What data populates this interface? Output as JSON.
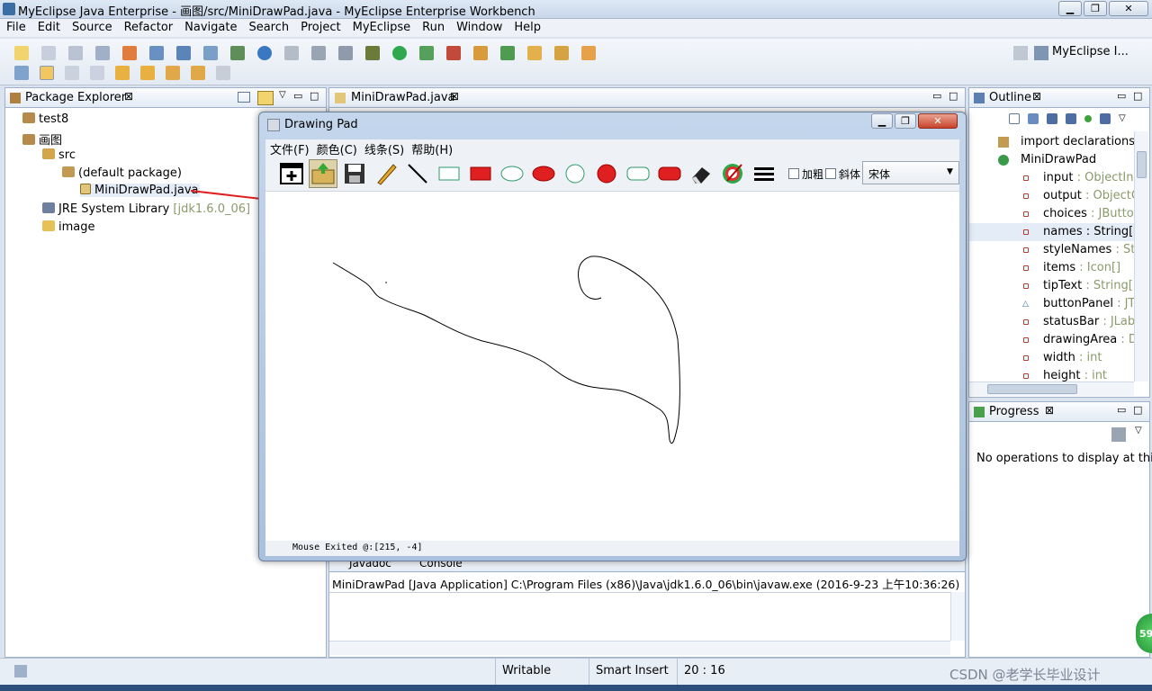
{
  "window": {
    "title": "MyEclipse Java Enterprise - 画图/src/MiniDrawPad.java - MyEclipse Enterprise Workbench"
  },
  "menu": [
    "File",
    "Edit",
    "Source",
    "Refactor",
    "Navigate",
    "Search",
    "Project",
    "MyEclipse",
    "Run",
    "Window",
    "Help"
  ],
  "perspective": {
    "label": "MyEclipse I..."
  },
  "package_explorer": {
    "tab": "Package Explorer",
    "items": [
      "test8",
      "画图",
      "src",
      "(default package)",
      "MiniDrawPad.java",
      "JRE System Library",
      "[jdk1.6.0_06]",
      "image"
    ]
  },
  "editor": {
    "tab": "MiniDrawPad.java"
  },
  "outline": {
    "tab": "Outline",
    "rows": [
      {
        "name": "import declarations",
        "type": ""
      },
      {
        "name": "MiniDrawPad",
        "type": ""
      },
      {
        "name": "input",
        "type": " : ObjectInp"
      },
      {
        "name": "output",
        "type": " : ObjectO"
      },
      {
        "name": "choices",
        "type": " : JButton"
      },
      {
        "name": "names",
        "type": " : String[]"
      },
      {
        "name": "styleNames",
        "type": " : Stri"
      },
      {
        "name": "items",
        "type": " : Icon[]"
      },
      {
        "name": "tipText",
        "type": " : String[]"
      },
      {
        "name": "buttonPanel",
        "type": " : JTc"
      },
      {
        "name": "statusBar",
        "type": " : JLabe"
      },
      {
        "name": "drawingArea",
        "type": " : Dr"
      },
      {
        "name": "width",
        "type": " : int"
      },
      {
        "name": "height",
        "type": " : int"
      }
    ]
  },
  "progress": {
    "tab": "Progress",
    "message": "No operations to display at this"
  },
  "console": {
    "tabs": [
      "Javadoc",
      "Console"
    ],
    "line": "MiniDrawPad [Java Application] C:\\Program Files (x86)\\Java\\jdk1.6.0_06\\bin\\javaw.exe (2016-9-23 上午10:36:26)"
  },
  "drawing_pad": {
    "title": "Drawing Pad",
    "menu": [
      "文件(F)",
      "颜色(C)",
      "线条(S)",
      "帮助(H)"
    ],
    "bold_label": "加粗",
    "italic_label": "斜体",
    "font_value": "宋体",
    "status": "Mouse Exited @:[215, -4]"
  },
  "statusbar": {
    "writable": "Writable",
    "insert_mode": "Smart Insert",
    "position": "20 : 16"
  },
  "watermark": "CSDN @老学长毕业设计",
  "badge": "59"
}
